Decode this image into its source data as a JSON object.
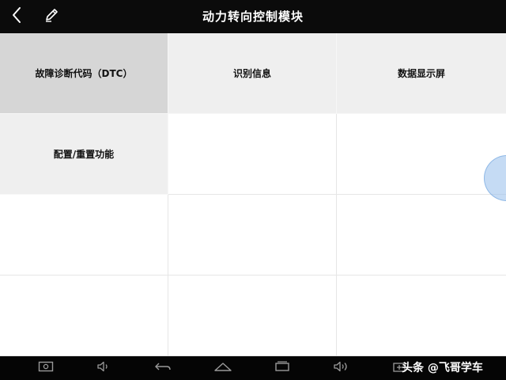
{
  "header": {
    "title": "动力转向控制模块",
    "back_icon": "chevron-left-icon",
    "edit_icon": "pencil-icon"
  },
  "tiles": [
    {
      "label": "故障诊断代码（DTC）",
      "active": true
    },
    {
      "label": "识别信息",
      "active": false
    },
    {
      "label": "数据显示屏",
      "active": false
    },
    {
      "label": "配置/重置功能",
      "active": false
    }
  ],
  "navbar": {
    "icons": [
      "screenshot-icon",
      "volume-down-icon",
      "back-arrow-icon",
      "home-icon",
      "recent-apps-icon",
      "volume-up-icon",
      "add-window-icon"
    ]
  },
  "watermark": {
    "text": "头条 @飞哥学车"
  },
  "colors": {
    "bar_bg": "#0b0b0b",
    "tile_bg": "#efefef",
    "tile_active_bg": "#d6d6d6",
    "float_ball": "#96bee b"
  }
}
